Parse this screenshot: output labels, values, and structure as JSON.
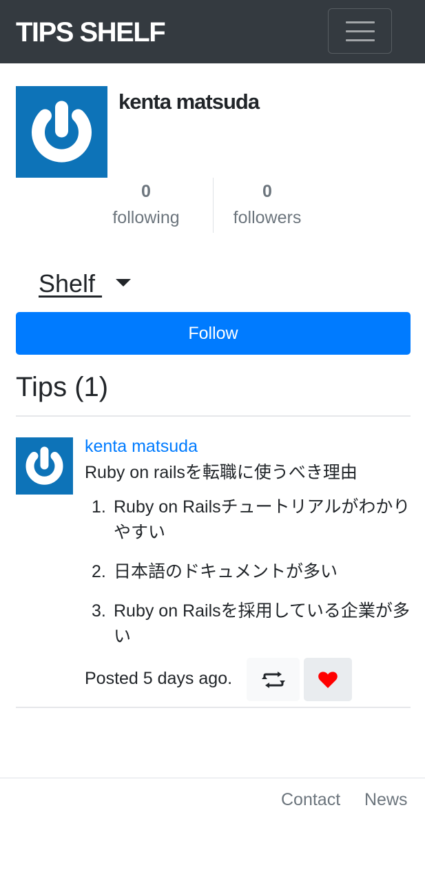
{
  "navbar": {
    "brand": "TIPS SHELF",
    "menu_icon": "hamburger-icon"
  },
  "profile": {
    "name": "kenta matsuda",
    "avatar_icon": "power-icon",
    "following_count": "0",
    "following_label": "following",
    "followers_count": "0",
    "followers_label": "followers",
    "shelf_label": "Shelf ",
    "follow_button": "Follow"
  },
  "tips": {
    "heading": "Tips (1)",
    "items": [
      {
        "author": "kenta matsuda",
        "title": "Ruby on railsを転職に使うべき理由",
        "list": [
          {
            "num": "1.",
            "text": "Ruby on Railsチュートリアルがわかりやすい"
          },
          {
            "num": "2.",
            "text": "日本語のドキュメントが多い"
          },
          {
            "num": "3.",
            "text": "Ruby on Railsを採用している企業が多い"
          }
        ],
        "posted": "Posted 5 days ago.",
        "retweet_icon": "retweet-icon",
        "like_icon": "heart-icon"
      }
    ]
  },
  "footer": {
    "links": [
      "Contact",
      "News"
    ]
  },
  "colors": {
    "navbar_bg": "#343a40",
    "primary": "#007bff",
    "avatar_bg": "#0d73b8",
    "heart": "#ff0000",
    "muted": "#6c757d"
  }
}
